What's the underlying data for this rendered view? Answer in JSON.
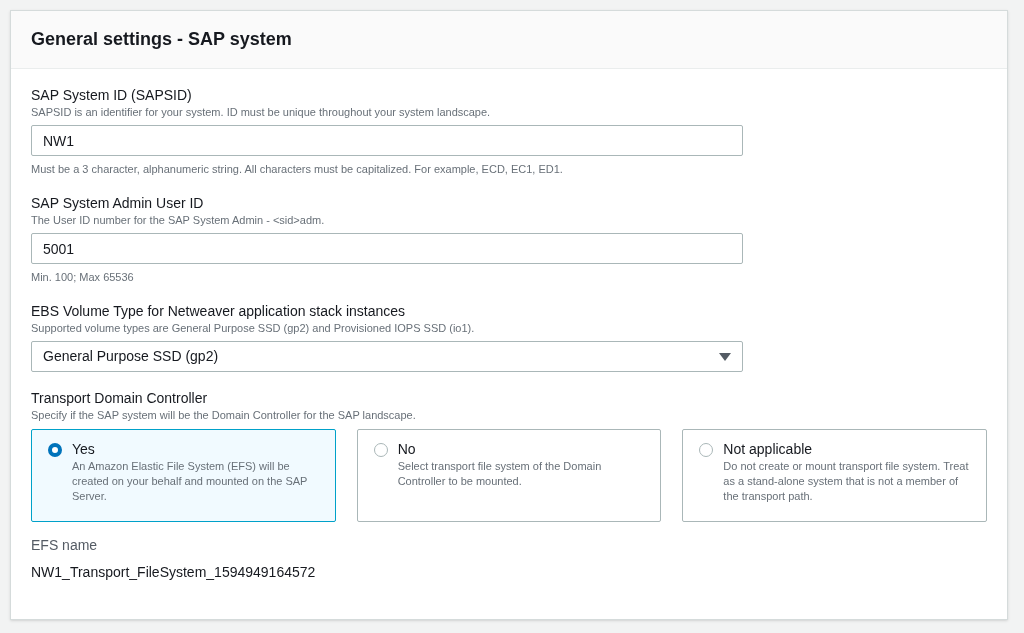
{
  "panel": {
    "title": "General settings - SAP system"
  },
  "fields": [
    {
      "kind": "text",
      "label": "SAP System ID (SAPSID)",
      "description": "SAPSID is an identifier for your system. ID must be unique throughout your system landscape.",
      "value": "NW1",
      "hint": "Must be a 3 character, alphanumeric string. All characters must be capitalized. For example, ECD, EC1, ED1."
    },
    {
      "kind": "text",
      "label": "SAP System Admin User ID",
      "description": "The User ID number for the SAP System Admin - <sid>adm.",
      "value": "5001",
      "hint": "Min. 100; Max 65536"
    },
    {
      "kind": "select",
      "label": "EBS Volume Type for Netweaver application stack instances",
      "description": "Supported volume types are General Purpose SSD (gp2) and Provisioned IOPS SSD (io1).",
      "value": "General Purpose SSD (gp2)"
    }
  ],
  "transport": {
    "label": "Transport Domain Controller",
    "description": "Specify if the SAP system will be the Domain Controller for the SAP landscape.",
    "options": [
      {
        "label": "Yes",
        "description": "An Amazon Elastic File System (EFS) will be created on your behalf and mounted on the SAP Server.",
        "selected": true
      },
      {
        "label": "No",
        "description": "Select transport file system of the Domain Controller to be mounted.",
        "selected": false
      },
      {
        "label": "Not applicable",
        "description": "Do not create or mount transport file system. Treat as a stand-alone system that is not a member of the transport path.",
        "selected": false
      }
    ]
  },
  "efs": {
    "label": "EFS name",
    "value": "NW1_Transport_FileSystem_1594949164572"
  }
}
